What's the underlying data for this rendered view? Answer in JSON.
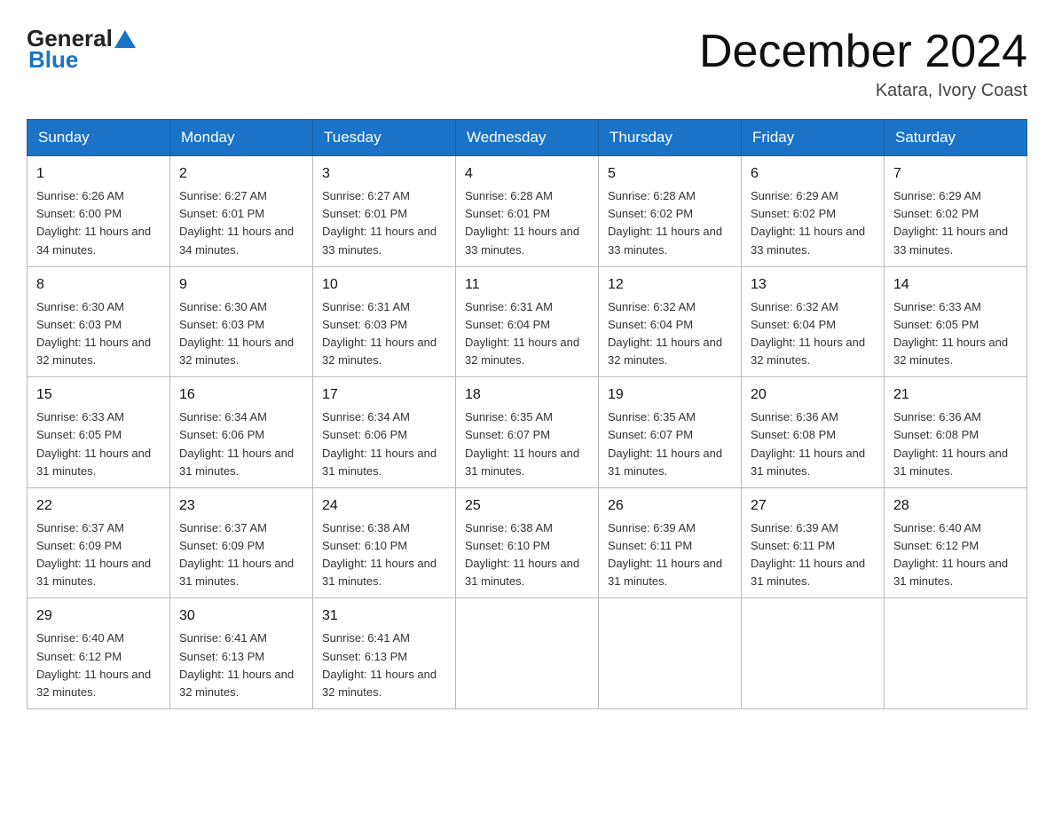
{
  "header": {
    "logo": {
      "general": "General",
      "blue": "Blue"
    },
    "title": "December 2024",
    "location": "Katara, Ivory Coast"
  },
  "weekdays": [
    "Sunday",
    "Monday",
    "Tuesday",
    "Wednesday",
    "Thursday",
    "Friday",
    "Saturday"
  ],
  "weeks": [
    [
      {
        "day": "1",
        "sunrise": "6:26 AM",
        "sunset": "6:00 PM",
        "daylight": "11 hours and 34 minutes."
      },
      {
        "day": "2",
        "sunrise": "6:27 AM",
        "sunset": "6:01 PM",
        "daylight": "11 hours and 34 minutes."
      },
      {
        "day": "3",
        "sunrise": "6:27 AM",
        "sunset": "6:01 PM",
        "daylight": "11 hours and 33 minutes."
      },
      {
        "day": "4",
        "sunrise": "6:28 AM",
        "sunset": "6:01 PM",
        "daylight": "11 hours and 33 minutes."
      },
      {
        "day": "5",
        "sunrise": "6:28 AM",
        "sunset": "6:02 PM",
        "daylight": "11 hours and 33 minutes."
      },
      {
        "day": "6",
        "sunrise": "6:29 AM",
        "sunset": "6:02 PM",
        "daylight": "11 hours and 33 minutes."
      },
      {
        "day": "7",
        "sunrise": "6:29 AM",
        "sunset": "6:02 PM",
        "daylight": "11 hours and 33 minutes."
      }
    ],
    [
      {
        "day": "8",
        "sunrise": "6:30 AM",
        "sunset": "6:03 PM",
        "daylight": "11 hours and 32 minutes."
      },
      {
        "day": "9",
        "sunrise": "6:30 AM",
        "sunset": "6:03 PM",
        "daylight": "11 hours and 32 minutes."
      },
      {
        "day": "10",
        "sunrise": "6:31 AM",
        "sunset": "6:03 PM",
        "daylight": "11 hours and 32 minutes."
      },
      {
        "day": "11",
        "sunrise": "6:31 AM",
        "sunset": "6:04 PM",
        "daylight": "11 hours and 32 minutes."
      },
      {
        "day": "12",
        "sunrise": "6:32 AM",
        "sunset": "6:04 PM",
        "daylight": "11 hours and 32 minutes."
      },
      {
        "day": "13",
        "sunrise": "6:32 AM",
        "sunset": "6:04 PM",
        "daylight": "11 hours and 32 minutes."
      },
      {
        "day": "14",
        "sunrise": "6:33 AM",
        "sunset": "6:05 PM",
        "daylight": "11 hours and 32 minutes."
      }
    ],
    [
      {
        "day": "15",
        "sunrise": "6:33 AM",
        "sunset": "6:05 PM",
        "daylight": "11 hours and 31 minutes."
      },
      {
        "day": "16",
        "sunrise": "6:34 AM",
        "sunset": "6:06 PM",
        "daylight": "11 hours and 31 minutes."
      },
      {
        "day": "17",
        "sunrise": "6:34 AM",
        "sunset": "6:06 PM",
        "daylight": "11 hours and 31 minutes."
      },
      {
        "day": "18",
        "sunrise": "6:35 AM",
        "sunset": "6:07 PM",
        "daylight": "11 hours and 31 minutes."
      },
      {
        "day": "19",
        "sunrise": "6:35 AM",
        "sunset": "6:07 PM",
        "daylight": "11 hours and 31 minutes."
      },
      {
        "day": "20",
        "sunrise": "6:36 AM",
        "sunset": "6:08 PM",
        "daylight": "11 hours and 31 minutes."
      },
      {
        "day": "21",
        "sunrise": "6:36 AM",
        "sunset": "6:08 PM",
        "daylight": "11 hours and 31 minutes."
      }
    ],
    [
      {
        "day": "22",
        "sunrise": "6:37 AM",
        "sunset": "6:09 PM",
        "daylight": "11 hours and 31 minutes."
      },
      {
        "day": "23",
        "sunrise": "6:37 AM",
        "sunset": "6:09 PM",
        "daylight": "11 hours and 31 minutes."
      },
      {
        "day": "24",
        "sunrise": "6:38 AM",
        "sunset": "6:10 PM",
        "daylight": "11 hours and 31 minutes."
      },
      {
        "day": "25",
        "sunrise": "6:38 AM",
        "sunset": "6:10 PM",
        "daylight": "11 hours and 31 minutes."
      },
      {
        "day": "26",
        "sunrise": "6:39 AM",
        "sunset": "6:11 PM",
        "daylight": "11 hours and 31 minutes."
      },
      {
        "day": "27",
        "sunrise": "6:39 AM",
        "sunset": "6:11 PM",
        "daylight": "11 hours and 31 minutes."
      },
      {
        "day": "28",
        "sunrise": "6:40 AM",
        "sunset": "6:12 PM",
        "daylight": "11 hours and 31 minutes."
      }
    ],
    [
      {
        "day": "29",
        "sunrise": "6:40 AM",
        "sunset": "6:12 PM",
        "daylight": "11 hours and 32 minutes."
      },
      {
        "day": "30",
        "sunrise": "6:41 AM",
        "sunset": "6:13 PM",
        "daylight": "11 hours and 32 minutes."
      },
      {
        "day": "31",
        "sunrise": "6:41 AM",
        "sunset": "6:13 PM",
        "daylight": "11 hours and 32 minutes."
      },
      null,
      null,
      null,
      null
    ]
  ]
}
